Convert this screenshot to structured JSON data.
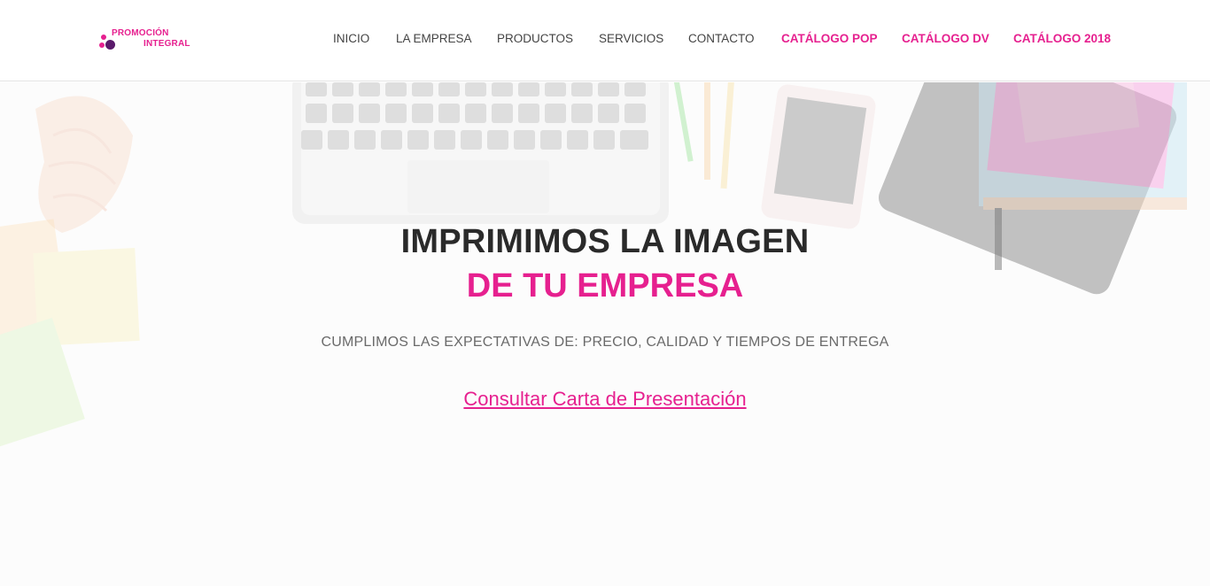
{
  "brand": {
    "line1": "PROMOCIÓN",
    "line2": "INTEGRAL",
    "colors": {
      "primary": "#e6208f",
      "dark": "#5a1a6b"
    }
  },
  "nav": {
    "items": [
      {
        "label": "INICIO",
        "highlight": false
      },
      {
        "label": "LA EMPRESA",
        "highlight": false
      },
      {
        "label": "PRODUCTOS",
        "highlight": false
      },
      {
        "label": "SERVICIOS",
        "highlight": false
      },
      {
        "label": "CONTACTO",
        "highlight": false
      },
      {
        "label": "CATÁLOGO POP",
        "highlight": true
      },
      {
        "label": "CATÁLOGO DV",
        "highlight": true
      },
      {
        "label": "CATÁLOGO 2018",
        "highlight": true
      }
    ]
  },
  "hero": {
    "title_line1": "IMPRIMIMOS LA IMAGEN",
    "title_line2": "DE TU EMPRESA",
    "subtitle": "CUMPLIMOS LAS EXPECTATIVAS DE: PRECIO, CALIDAD Y TIEMPOS DE ENTREGA",
    "link_label": "Consultar Carta de Presentación",
    "background_icons": [
      "seashell",
      "laptop",
      "pencils",
      "smartphone",
      "tablet",
      "notebooks",
      "sticky-notes"
    ]
  }
}
